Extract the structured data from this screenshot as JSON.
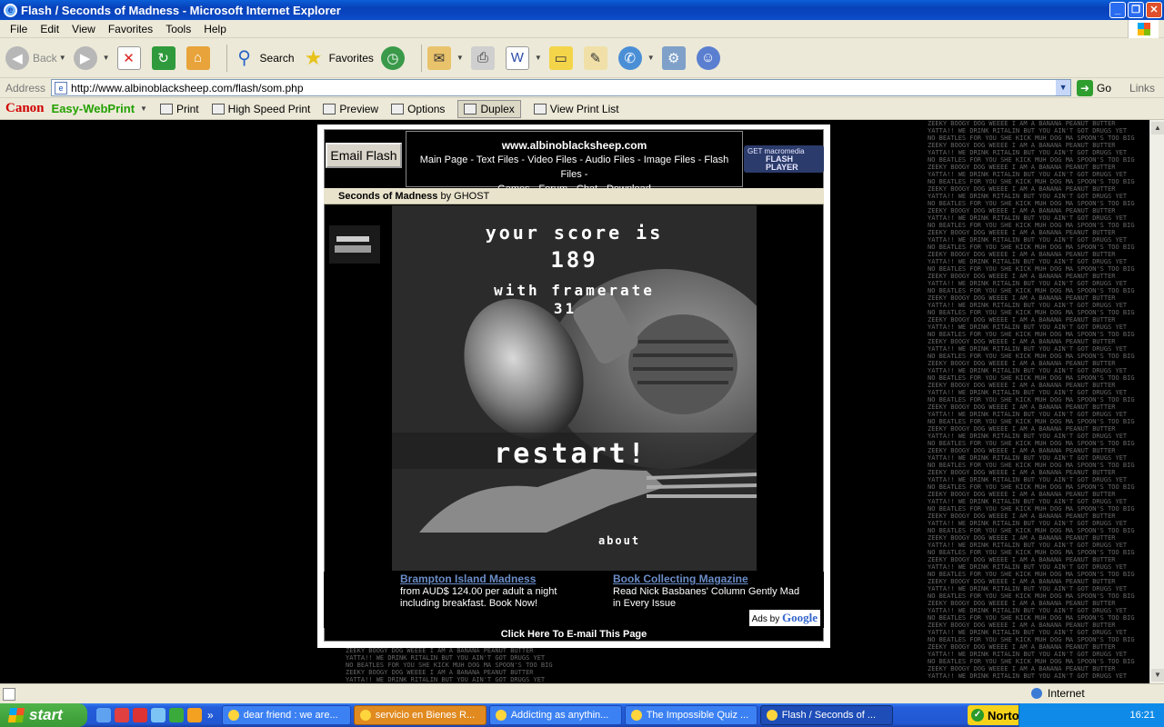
{
  "window": {
    "title": "Flash / Seconds of Madness - Microsoft Internet Explorer"
  },
  "menu": [
    "File",
    "Edit",
    "View",
    "Favorites",
    "Tools",
    "Help"
  ],
  "toolbar": {
    "back": "Back",
    "search": "Search",
    "favorites": "Favorites"
  },
  "address": {
    "label": "Address",
    "url": "http://www.albinoblacksheep.com/flash/som.php",
    "go": "Go",
    "links": "Links"
  },
  "canon": {
    "brand": "Canon",
    "product": "Easy-WebPrint",
    "print": "Print",
    "high_speed": "High Speed Print",
    "preview": "Preview",
    "options": "Options",
    "duplex": "Duplex",
    "view_list": "View Print List"
  },
  "site": {
    "email_flash": "Email Flash",
    "url": "www.albinoblacksheep.com",
    "nav_line1": "Main Page - Text Files - Video Files - Audio Files - Image Files - Flash Files -",
    "nav_line2": "Games - Forum - Chat - Download",
    "flash_badge_get": "GET macromedia",
    "flash_badge_name": "FLASH PLAYER",
    "game_title": "Seconds of Madness",
    "game_by": "by GHOST"
  },
  "game": {
    "score_label": "your score is",
    "score": "189",
    "framerate_label": "with framerate",
    "framerate": "31",
    "restart": "restart!",
    "about": "about"
  },
  "ads": [
    {
      "title": "Brampton Island Madness",
      "line1": "from AUD$ 124.00 per adult a night",
      "line2": "including breakfast. Book Now!"
    },
    {
      "title": "Book Collecting Magazine",
      "line1": "Read Nick Basbanes' Column Gently Mad",
      "line2": "in Every Issue"
    }
  ],
  "ads_by": "Ads by",
  "google": "Google",
  "click_mail": "Click Here To E-mail This Page",
  "status": {
    "zone": "Internet"
  },
  "taskbar": {
    "start": "start",
    "tasks": [
      "dear friend : we are...",
      "servicio en Bienes R...",
      "Addicting as anythin...",
      "The Impossible Quiz ...",
      "Flash / Seconds of ..."
    ],
    "norton": "Norton",
    "clock": "16:21"
  },
  "colors": {
    "title_blue": "#0840b8",
    "chrome": "#ece9d8",
    "link": "#6a8cc7",
    "norton_yellow": "#f6d31a"
  }
}
